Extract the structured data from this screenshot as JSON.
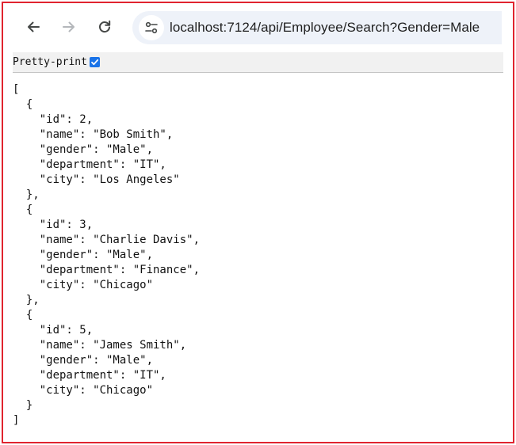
{
  "browser": {
    "url": "localhost:7124/api/Employee/Search?Gender=Male"
  },
  "viewer": {
    "pretty_print_label": "Pretty-print",
    "pretty_print_checked": true
  },
  "json_lines": [
    "[",
    "  {",
    "    \"id\": 2,",
    "    \"name\": \"Bob Smith\",",
    "    \"gender\": \"Male\",",
    "    \"department\": \"IT\",",
    "    \"city\": \"Los Angeles\"",
    "  },",
    "  {",
    "    \"id\": 3,",
    "    \"name\": \"Charlie Davis\",",
    "    \"gender\": \"Male\",",
    "    \"department\": \"Finance\",",
    "    \"city\": \"Chicago\"",
    "  },",
    "  {",
    "    \"id\": 5,",
    "    \"name\": \"James Smith\",",
    "    \"gender\": \"Male\",",
    "    \"department\": \"IT\",",
    "    \"city\": \"Chicago\"",
    "  }",
    "]"
  ],
  "colors": {
    "frame_border": "#e0242f",
    "omnibox_bg": "#eef2f9",
    "checkbox_accent": "#1a73e8"
  },
  "icons": {
    "back": "arrow-left-icon",
    "forward": "arrow-right-icon",
    "reload": "reload-icon",
    "site_info": "tune-icon",
    "checkbox": "checkmark-icon"
  }
}
